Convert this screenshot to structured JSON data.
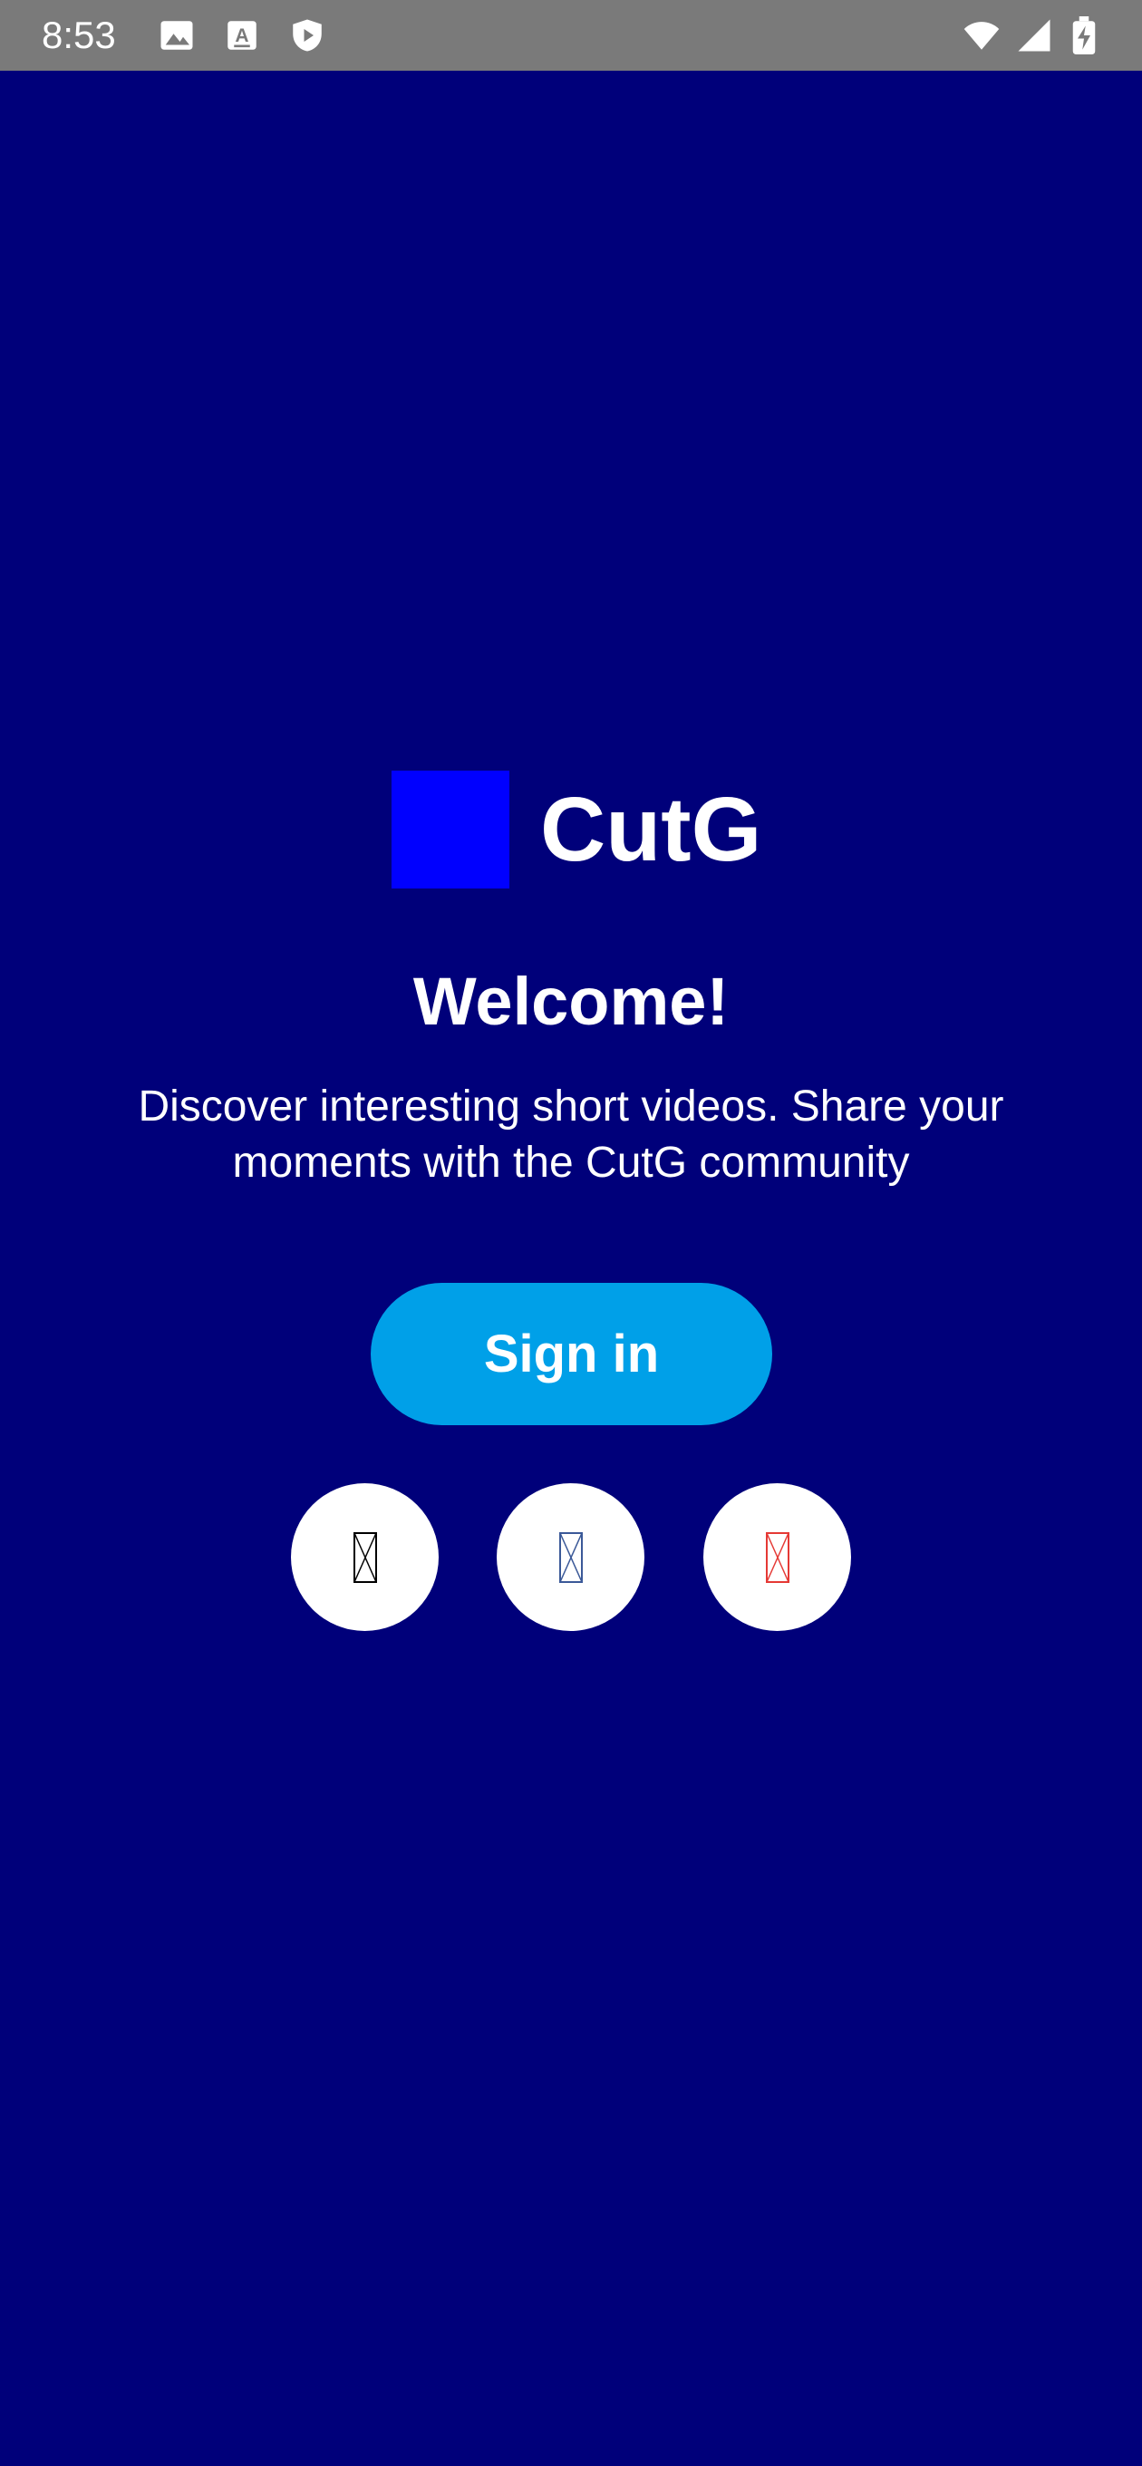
{
  "status_bar": {
    "time": "8:53",
    "icons": [
      "image-icon",
      "keyboard-a-icon",
      "shield-play-icon",
      "wifi-icon",
      "signal-icon",
      "battery-charging-icon"
    ]
  },
  "brand": {
    "name": "CutG",
    "logo_color": "#0000ff"
  },
  "welcome": {
    "title": "Welcome!",
    "description": "Discover interesting short videos. Share your moments with the CutG community"
  },
  "sign_in": {
    "label": "Sign in",
    "color": "#00a0e8"
  },
  "social_logins": [
    {
      "icon": "missing-glyph-icon",
      "color": "#000000"
    },
    {
      "icon": "missing-glyph-icon",
      "color": "#3b5998"
    },
    {
      "icon": "missing-glyph-icon",
      "color": "#e53935"
    }
  ],
  "colors": {
    "background": "#00007a",
    "status_bar": "#7a7a7a",
    "text": "#ffffff"
  }
}
